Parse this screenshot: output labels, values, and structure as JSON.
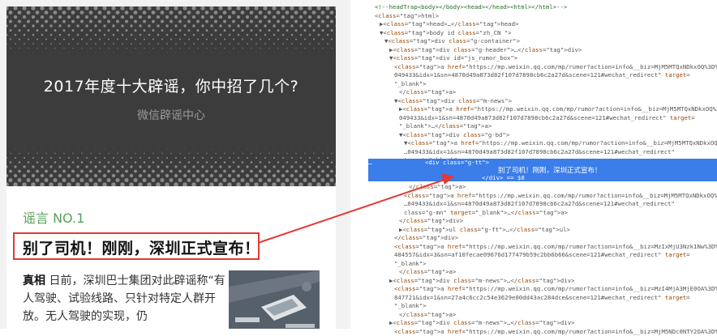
{
  "left_page": {
    "banner_title": "2017年度十大辟谣，你中招了几个?",
    "banner_subtitle": "微信辟谣中心",
    "rumor_number": "谣言 NO.1",
    "headline": "别了司机！刚刚，深圳正式宣布！",
    "truth_label": "真相",
    "truth_text": " 日前，深圳巴士集团对此辟谣称“有人驾驶、试验线路、只针对特定人群开放。无人驾驶的实现，仍"
  },
  "devtools": {
    "lines": [
      {
        "indent": 0,
        "text": "<!--headTrap<body></body><head></head><html></html>-->"
      },
      {
        "indent": 0,
        "text": "<html>"
      },
      {
        "indent": 1,
        "text": "▶<head>…</head>"
      },
      {
        "indent": 1,
        "text": "▼<body id class=\"zh_CN \">"
      },
      {
        "indent": 2,
        "text": "▼<div class=\"g-container\">"
      },
      {
        "indent": 3,
        "text": "▶<div class=\"g-header\">…</div>"
      },
      {
        "indent": 3,
        "text": "▼<div id=\"js_rumor_box\">"
      },
      {
        "indent": 4,
        "text": "<a href=\"https://mp.weixin.qq.com/mp/rumor?action=info&__biz=MjM5MTQxNDkxOQ%3D%"
      },
      {
        "indent": 4,
        "text": "049433&idx=1&sn=4870d49a873d82f107d7898cb6c2a27d&scene=121#wechat_redirect\" target="
      },
      {
        "indent": 4,
        "text": "\"_blank\">"
      },
      {
        "indent": 5,
        "text": "</a>"
      },
      {
        "indent": 4,
        "text": "▼<div class=\"m-news\">"
      },
      {
        "indent": 5,
        "text": "▶<a href=\"https://mp.weixin.qq.com/mp/rumor?action=info&__biz=MjM5MTQxNDkxOQ%3D%"
      },
      {
        "indent": 5,
        "text": "049433&idx=1&sn=4870d49a873d82f107d7898cb6c2a27d&scene=121#wechat_redirect\" target="
      },
      {
        "indent": 5,
        "text": "\"_blank\">…</a>"
      },
      {
        "indent": 5,
        "text": "▼<div class=\"g-bd\">"
      },
      {
        "indent": 6,
        "text": "▼<a href=\"https://mp.weixin.qq.com/mp/rumor?action=info&__biz=MjM5MTQxNDkxOQ%3D%"
      },
      {
        "indent": 6,
        "text": "…049433&idx=1&sn=4870d49a873d82f107d7898cb6c2a27d&scene=121#wechat_redirect\""
      },
      {
        "indent": 6,
        "text": "target=\"_blank\">"
      }
    ],
    "selected_open": "<div class=\"g-tt\">",
    "selected_text": "别了司机！刚刚，深圳正式宣布！",
    "selected_close": "</div> == $0",
    "selected_dots": "…",
    "lines_after": [
      {
        "indent": 7,
        "text": "</a>"
      },
      {
        "indent": 6,
        "text": "<a href=\"https://mp.weixin.qq.com/mp/rumor?action=info&__biz=MjM5MTQxNDkxOQ%3D%"
      },
      {
        "indent": 6,
        "text": "…049433&idx=1&sn=4870d49a873d82f107d7898cb6c2a27d&scene=121#wechat_redirect\""
      },
      {
        "indent": 6,
        "text": "class=\"g-mn\" target=\"_blank\">…</a>"
      },
      {
        "indent": 5,
        "text": "</div>"
      },
      {
        "indent": 5,
        "text": "▶<ul class=\"g-ft\">…</ul>"
      },
      {
        "indent": 4,
        "text": "</div>"
      },
      {
        "indent": 4,
        "text": "<a href=\"https://mp.weixin.qq.com/mp/rumor?action=info&__biz=MzIxMjU3Nzk1Nw%3D%"
      },
      {
        "indent": 4,
        "text": "484557&idx=3&sn=af10fecae09676d177479b59c2bb6b66&scene=121#wechat_redirect\" target="
      },
      {
        "indent": 4,
        "text": "\"_blank\">"
      },
      {
        "indent": 5,
        "text": "</a>"
      },
      {
        "indent": 3,
        "text": "▶<div class=\"m-news\">…</div>"
      },
      {
        "indent": 4,
        "text": "<a href=\"https://mp.weixin.qq.com/mp/rumor?action=info&__biz=MzI4MjA3MjE0OA%3D%"
      },
      {
        "indent": 4,
        "text": "847721&idx=1&sn=27a4c6cc2c54e3629e00dd43ac284dce&scene=121#wechat_redirect\" target="
      },
      {
        "indent": 4,
        "text": "\"_blank\">"
      },
      {
        "indent": 5,
        "text": "</a>"
      },
      {
        "indent": 3,
        "text": "▶<div class=\"m-news\">…</div>"
      },
      {
        "indent": 4,
        "text": "<a href=\"https://mp.weixin.qq.com/mp/rumor?action=info&__biz=MjM5NDc0NTY2OA%3D%"
      }
    ]
  },
  "colors": {
    "highlight": "#e53935",
    "selection": "#3b7de9",
    "rumor_green": "#5aa05a"
  }
}
